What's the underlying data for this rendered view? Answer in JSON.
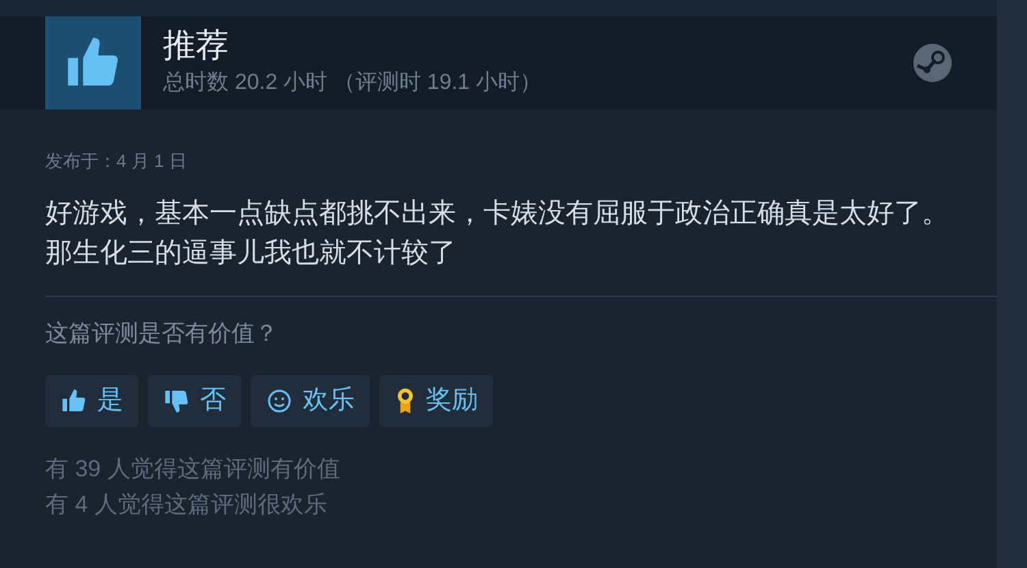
{
  "review": {
    "verdict": "推荐",
    "playtime": "总时数 20.2 小时 （评测时 19.1 小时）",
    "posted": "发布于：4 月 1 日",
    "body": "好游戏，基本一点缺点都挑不出来，卡婊没有屈服于政治正确真是太好了。那生化三的逼事儿我也就不计较了"
  },
  "helpful": {
    "question": "这篇评测是否有价值？",
    "buttons": [
      {
        "kind": "yes",
        "label": "是"
      },
      {
        "kind": "no",
        "label": "否"
      },
      {
        "kind": "funny",
        "label": "欢乐"
      },
      {
        "kind": "award",
        "label": "奖励"
      }
    ]
  },
  "stats": [
    "有 39 人觉得这篇评测有价值",
    "有 4 人觉得这篇评测很欢乐"
  ]
}
